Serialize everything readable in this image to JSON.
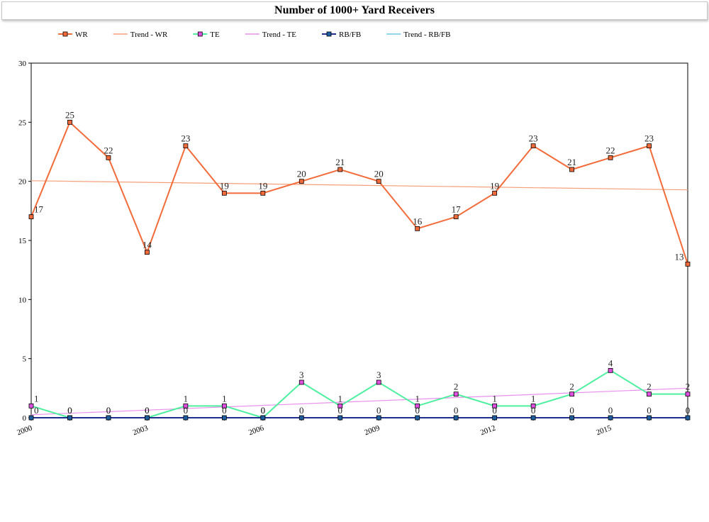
{
  "chart_data": {
    "type": "line",
    "title": "Number of 1000+ Yard Receivers",
    "x": [
      2000,
      2001,
      2002,
      2003,
      2004,
      2005,
      2006,
      2007,
      2008,
      2009,
      2010,
      2011,
      2012,
      2013,
      2014,
      2015,
      2016,
      2017
    ],
    "x_tick_labels": [
      "2000",
      "2003",
      "2006",
      "2009",
      "2012",
      "2015"
    ],
    "y_ticks": [
      "0",
      "5",
      "10",
      "15",
      "20",
      "25",
      "30"
    ],
    "ylim": [
      0,
      30
    ],
    "legend_position": "top-left",
    "grid": false,
    "series": [
      {
        "name": "WR",
        "key": "wr",
        "color": "#f26b3a",
        "marker_color": "#f26b3a",
        "values": [
          17,
          25,
          22,
          14,
          23,
          19,
          19,
          20,
          21,
          20,
          16,
          17,
          19,
          23,
          21,
          22,
          23,
          13
        ]
      },
      {
        "name": "TE",
        "key": "te",
        "color": "#4ef0a0",
        "marker_color": "#e050e0",
        "values": [
          1,
          0,
          0,
          0,
          1,
          1,
          0,
          3,
          1,
          3,
          1,
          2,
          1,
          1,
          2,
          4,
          2,
          2
        ]
      },
      {
        "name": "RB/FB",
        "key": "rb",
        "color": "#1f2f8f",
        "marker_color": "#1f5fa0",
        "values": [
          0,
          0,
          0,
          0,
          0,
          0,
          0,
          0,
          0,
          0,
          0,
          0,
          0,
          0,
          0,
          0,
          0,
          0
        ]
      }
    ],
    "trendlines": [
      {
        "name": "Trend - WR",
        "key": "wr",
        "color": "#f4a07a",
        "start": 20.05,
        "end": 19.28
      },
      {
        "name": "Trend - TE",
        "key": "te",
        "color": "#e890ec",
        "start": 0.25,
        "end": 2.5
      },
      {
        "name": "Trend - RB/FB",
        "key": "rb",
        "color": "#6ec8e8",
        "start": 0,
        "end": 0
      }
    ],
    "legend": [
      {
        "label": "WR",
        "kind": "series",
        "color": "#f26b3a",
        "marker_color": "#f26b3a"
      },
      {
        "label": "Trend - WR",
        "kind": "trend",
        "color": "#f4a07a"
      },
      {
        "label": "TE",
        "kind": "series",
        "color": "#4ef0a0",
        "marker_color": "#e050e0"
      },
      {
        "label": "Trend - TE",
        "kind": "trend",
        "color": "#e890ec"
      },
      {
        "label": "RB/FB",
        "kind": "series",
        "color": "#1f2f8f",
        "marker_color": "#1f5fa0"
      },
      {
        "label": "Trend - RB/FB",
        "kind": "trend",
        "color": "#6ec8e8"
      }
    ]
  }
}
